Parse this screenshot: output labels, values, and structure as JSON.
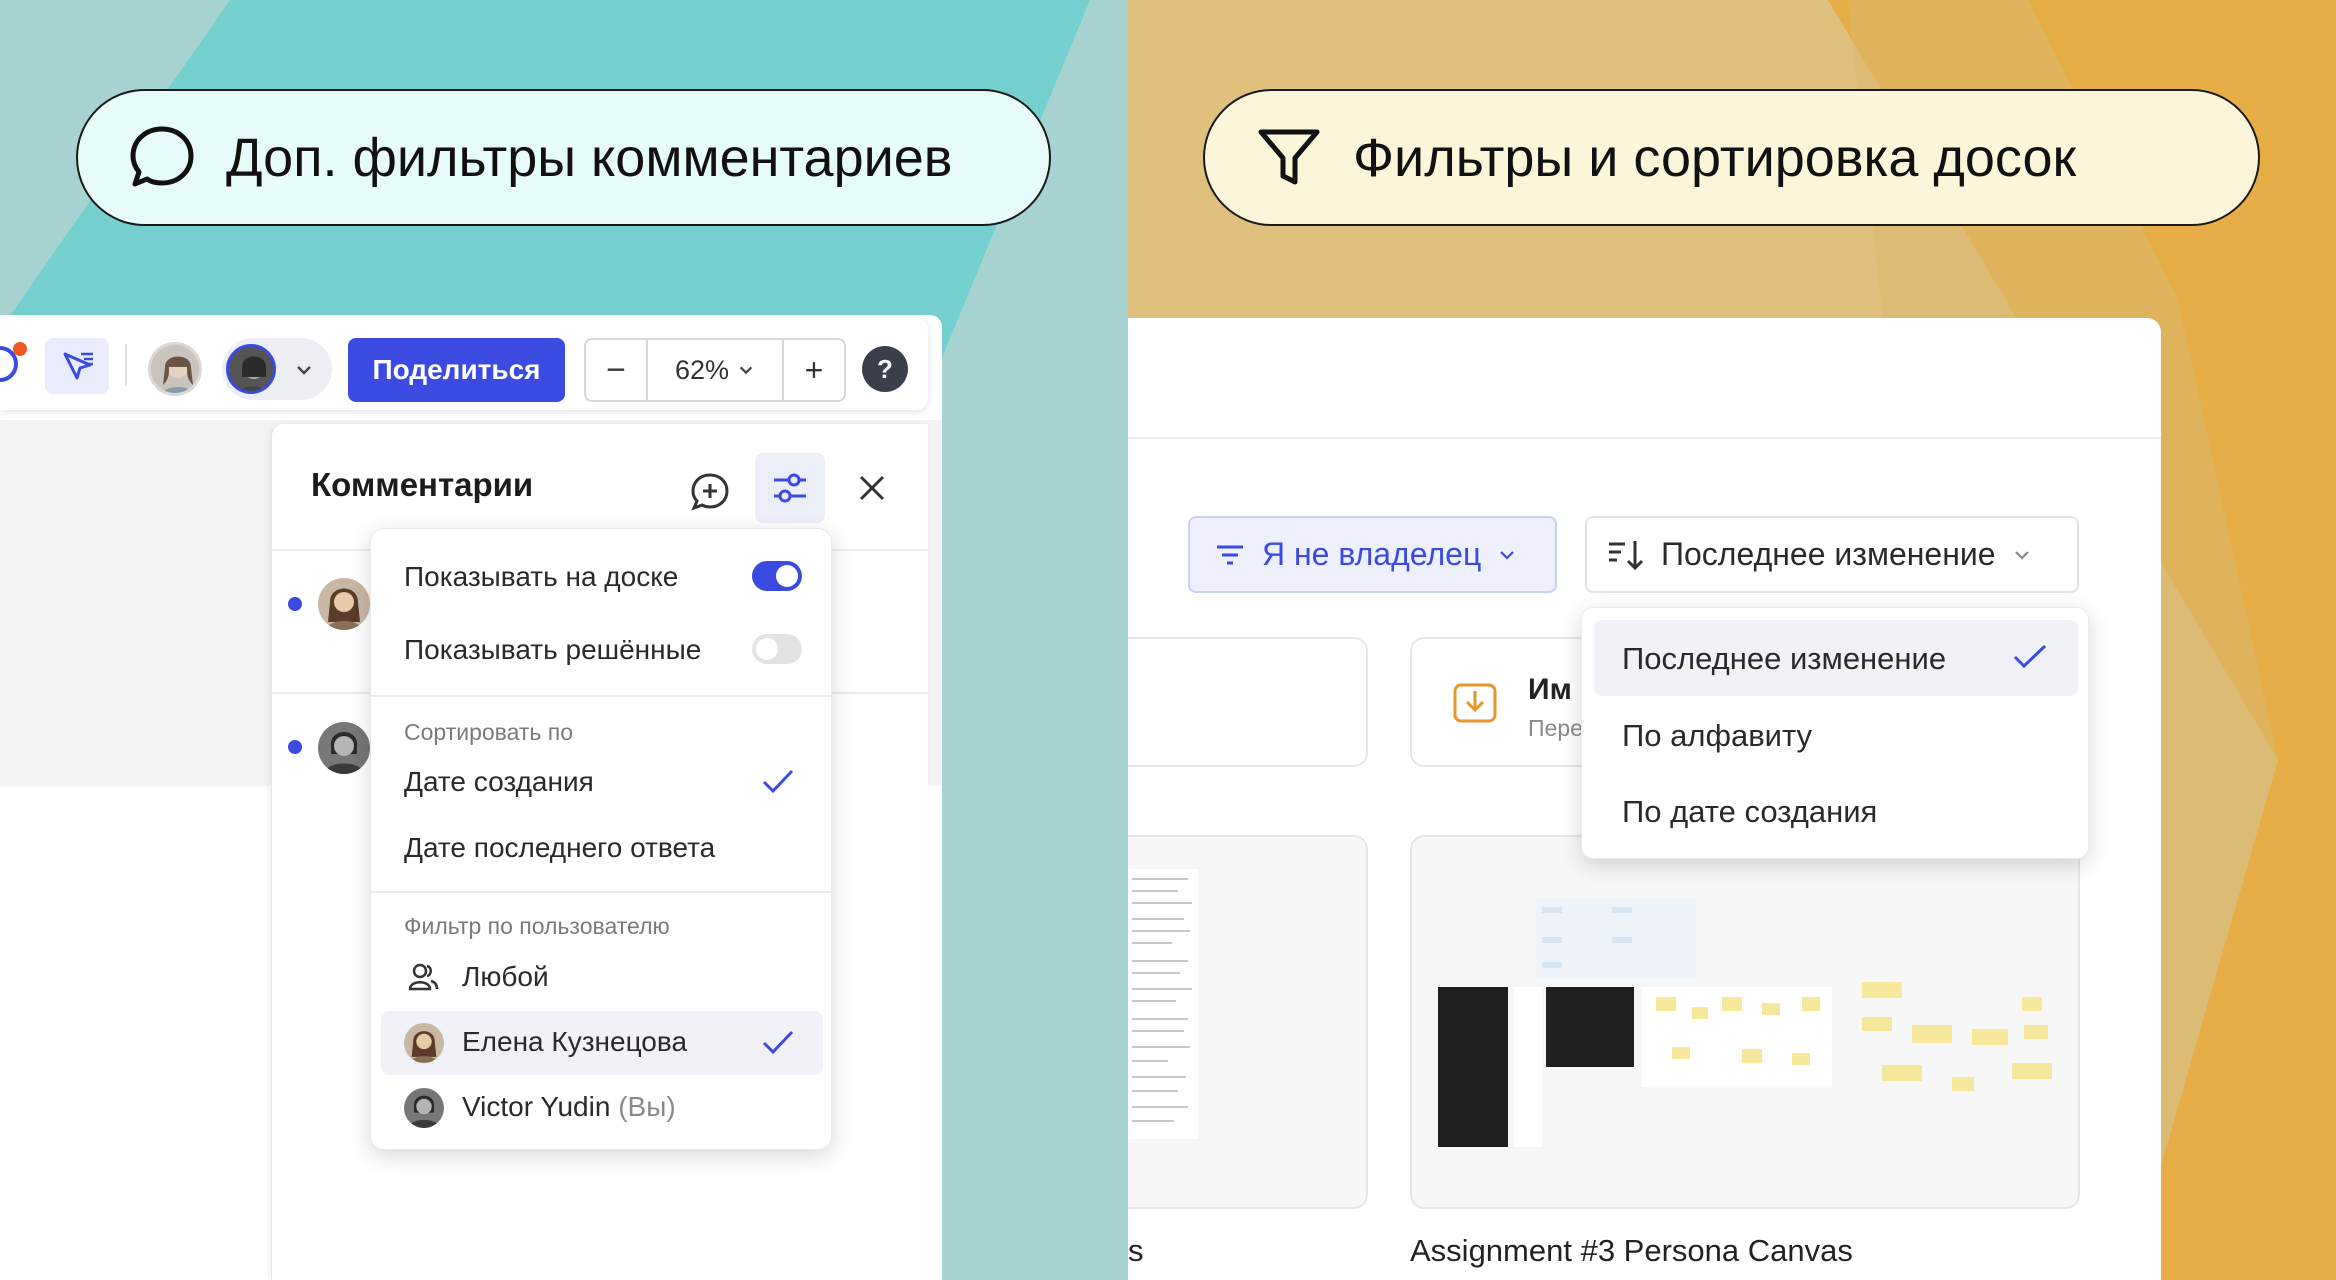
{
  "promo": {
    "left_title": "Доп. фильтры комментариев",
    "right_title": "Фильтры и сортировка досок"
  },
  "colors": {
    "accent": "#3b4ae0",
    "left_bg": "#a7d3d2",
    "right_bg": "#dfc07c"
  },
  "toolbar": {
    "share_label": "Поделиться",
    "zoom_minus": "−",
    "zoom_value": "62%",
    "zoom_plus": "+",
    "help_label": "?"
  },
  "comments": {
    "title": "Комментарии",
    "show_on_board": "Показывать на доске",
    "show_on_board_on": true,
    "show_resolved": "Показывать решённые",
    "show_resolved_on": false,
    "sort_heading": "Сортировать по",
    "sort_options": [
      "Дате создания",
      "Дате последнего ответа"
    ],
    "sort_selected": "Дате создания",
    "filter_heading": "Фильтр по пользователю",
    "users": [
      {
        "name": "Любой",
        "suffix": ""
      },
      {
        "name": "Елена Кузнецова",
        "suffix": ""
      },
      {
        "name": "Victor Yudin",
        "suffix": "(Вы)"
      }
    ],
    "user_selected": "Елена Кузнецова"
  },
  "boards": {
    "owner_filter": "Я не владелец",
    "sort_button": "Последнее изменение",
    "sort_options": [
      "Последнее изменение",
      "По алфавиту",
      "По дате создания"
    ],
    "sort_selected": "Последнее изменение",
    "import_title": "Им",
    "import_sub": "Пере",
    "card_left_title_tail": "s",
    "card_right_title": "Assignment #3 Persona Canvas"
  }
}
